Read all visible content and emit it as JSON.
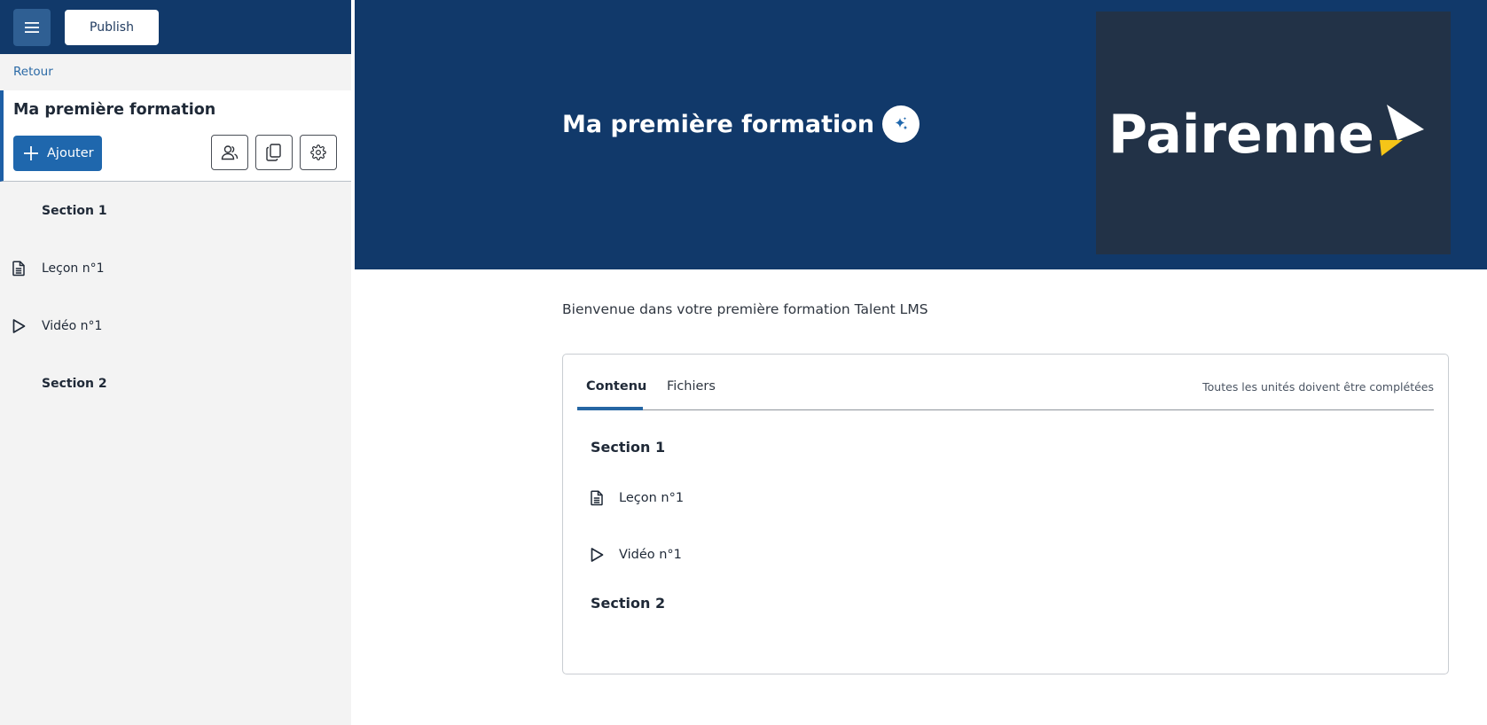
{
  "toolbar": {
    "publish_label": "Publish"
  },
  "sidebar": {
    "back_label": "Retour",
    "course_title": "Ma première formation",
    "add_label": "Ajouter",
    "items": [
      {
        "label": "Section 1",
        "type": "section"
      },
      {
        "label": "Leçon n°1",
        "type": "lesson",
        "icon": "document-icon"
      },
      {
        "label": "Vidéo n°1",
        "type": "video",
        "icon": "play-icon"
      },
      {
        "label": "Section 2",
        "type": "section"
      }
    ]
  },
  "hero": {
    "title": "Ma première formation",
    "logo_text": "Pairenne",
    "background_color": "#11396a",
    "logo_background": "#223247",
    "logo_accent": "#f5c518"
  },
  "main": {
    "intro": "Bienvenue dans votre première formation Talent LMS",
    "tabs": [
      {
        "label": "Contenu",
        "active": true
      },
      {
        "label": "Fichiers",
        "active": false
      }
    ],
    "completion_note": "Toutes les unités doivent être complétées",
    "content": [
      {
        "label": "Section 1",
        "type": "section"
      },
      {
        "label": "Leçon n°1",
        "type": "lesson",
        "icon": "document-icon"
      },
      {
        "label": "Vidéo n°1",
        "type": "video",
        "icon": "play-icon"
      },
      {
        "label": "Section 2",
        "type": "section"
      }
    ]
  }
}
